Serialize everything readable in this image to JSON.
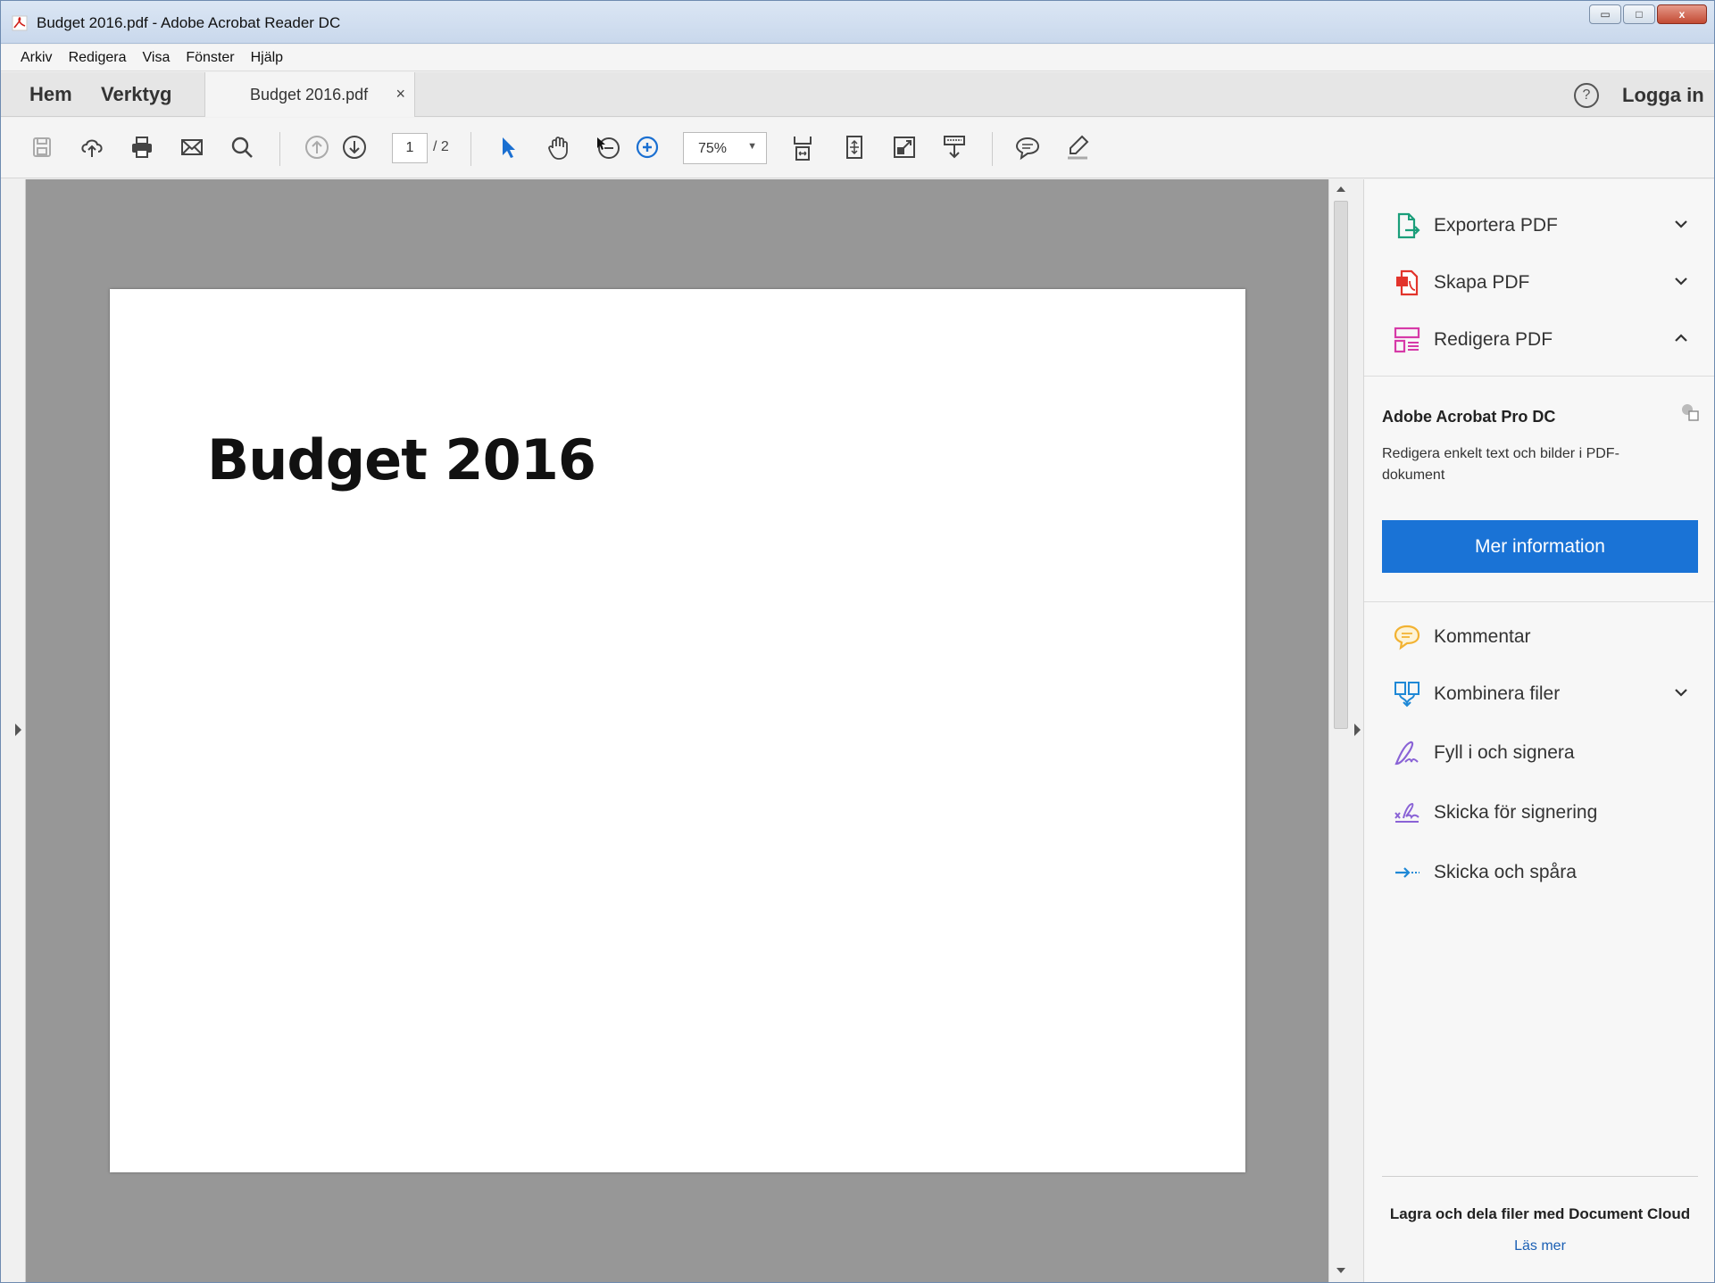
{
  "window": {
    "title": "Budget 2016.pdf - Adobe Acrobat Reader DC",
    "controls": {
      "minimize": "▭",
      "maximize": "□",
      "close": "x"
    }
  },
  "menu": [
    "Arkiv",
    "Redigera",
    "Visa",
    "Fönster",
    "Hjälp"
  ],
  "tabs": {
    "home": "Hem",
    "tools": "Verktyg",
    "document": "Budget 2016.pdf",
    "close": "×",
    "help": "?",
    "login": "Logga in"
  },
  "toolbar": {
    "page_current": "1",
    "page_total": "/ 2",
    "zoom": "75%",
    "zoom_caret": "▼",
    "icons": [
      "save-icon",
      "upload-icon",
      "print-icon",
      "email-icon",
      "search-icon",
      "page-up-icon",
      "page-down-icon",
      "select-cursor-icon",
      "hand-icon",
      "zoom-out-icon",
      "zoom-in-icon",
      "scroll-mode-icon",
      "fit-page-icon",
      "full-screen-icon",
      "read-mode-icon",
      "comment-icon",
      "highlight-icon"
    ]
  },
  "document": {
    "heading": "Budget 2016"
  },
  "right_panel": {
    "tools_top": [
      {
        "label": "Exportera PDF",
        "icon": "export-pdf-icon",
        "color": "#1a9e7a",
        "state": "collapsed"
      },
      {
        "label": "Skapa PDF",
        "icon": "create-pdf-icon",
        "color": "#e2342c",
        "state": "collapsed"
      },
      {
        "label": "Redigera PDF",
        "icon": "edit-pdf-icon",
        "color": "#d63aa8",
        "state": "expanded"
      }
    ],
    "promo": {
      "title": "Adobe Acrobat Pro DC",
      "description": "Redigera enkelt text och bilder i PDF-dokument",
      "button": "Mer information",
      "button_color": "#1a73d6"
    },
    "tools_bottom": [
      {
        "label": "Kommentar",
        "icon": "comment-icon",
        "color": "#f2b232",
        "chevron": false
      },
      {
        "label": "Kombinera filer",
        "icon": "combine-files-icon",
        "color": "#1e88d6",
        "chevron": true
      },
      {
        "label": "Fyll i och signera",
        "icon": "fill-sign-icon",
        "color": "#8a63d6",
        "chevron": false
      },
      {
        "label": "Skicka för signering",
        "icon": "send-for-signature-icon",
        "color": "#8a63d6",
        "chevron": false
      },
      {
        "label": "Skicka och spåra",
        "icon": "send-track-icon",
        "color": "#1e88d6",
        "chevron": false
      }
    ],
    "cloud": {
      "title": "Lagra och dela filer med Document Cloud",
      "link": "Läs mer"
    }
  }
}
